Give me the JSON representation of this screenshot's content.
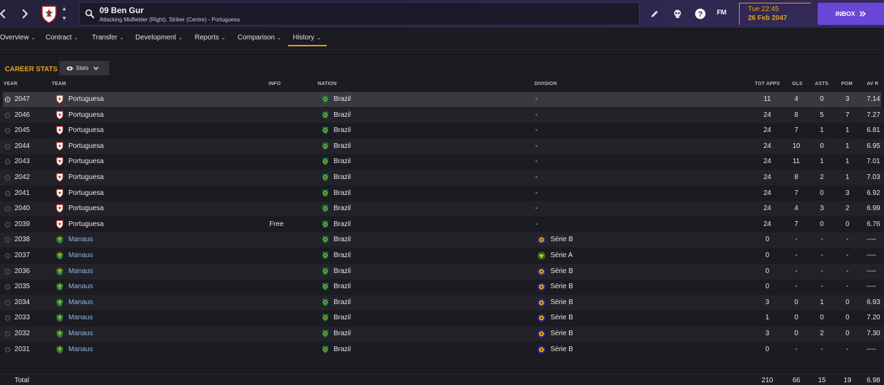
{
  "header": {
    "player_name": "09 Ben Gur",
    "player_positions": "Attacking Midfielder (Right), Striker (Centre) - Portuguesa",
    "time": "Tue 22:45",
    "date": "26 Feb 2047",
    "fm_label": "FM",
    "inbox_label": "INBOX",
    "accent": "#e8a21c",
    "inbox_color": "#6a46d6"
  },
  "tabs": [
    {
      "label": "Overview"
    },
    {
      "label": "Contract"
    },
    {
      "label": "Transfer"
    },
    {
      "label": "Development"
    },
    {
      "label": "Reports"
    },
    {
      "label": "Comparison"
    },
    {
      "label": "History"
    }
  ],
  "active_tab": "History",
  "section": {
    "title": "CAREER STATS",
    "view_dropdown": "Stats"
  },
  "columns": {
    "year": "YEAR",
    "team": "TEAM",
    "info": "INFO",
    "nation": "NATION",
    "division": "DIVISION",
    "apps": "TOT APPS",
    "gls": "GLS",
    "asts": "ASTS",
    "pom": "POM",
    "avr": "AV R"
  },
  "rows": [
    {
      "year": "2047",
      "team": "Portuguesa",
      "club": "portuguesa",
      "info": "",
      "nation": "Brazil",
      "division": "-",
      "div_badge": "",
      "apps": "11",
      "gls": "4",
      "asts": "0",
      "pom": "3",
      "avr": "7.14",
      "selected": true
    },
    {
      "year": "2046",
      "team": "Portuguesa",
      "club": "portuguesa",
      "info": "",
      "nation": "Brazil",
      "division": "-",
      "div_badge": "",
      "apps": "24",
      "gls": "8",
      "asts": "5",
      "pom": "7",
      "avr": "7.27"
    },
    {
      "year": "2045",
      "team": "Portuguesa",
      "club": "portuguesa",
      "info": "",
      "nation": "Brazil",
      "division": "-",
      "div_badge": "",
      "apps": "24",
      "gls": "7",
      "asts": "1",
      "pom": "1",
      "avr": "6.81"
    },
    {
      "year": "2044",
      "team": "Portuguesa",
      "club": "portuguesa",
      "info": "",
      "nation": "Brazil",
      "division": "-",
      "div_badge": "",
      "apps": "24",
      "gls": "10",
      "asts": "0",
      "pom": "1",
      "avr": "6.95"
    },
    {
      "year": "2043",
      "team": "Portuguesa",
      "club": "portuguesa",
      "info": "",
      "nation": "Brazil",
      "division": "-",
      "div_badge": "",
      "apps": "24",
      "gls": "11",
      "asts": "1",
      "pom": "1",
      "avr": "7.01"
    },
    {
      "year": "2042",
      "team": "Portuguesa",
      "club": "portuguesa",
      "info": "",
      "nation": "Brazil",
      "division": "-",
      "div_badge": "",
      "apps": "24",
      "gls": "8",
      "asts": "2",
      "pom": "1",
      "avr": "7.03"
    },
    {
      "year": "2041",
      "team": "Portuguesa",
      "club": "portuguesa",
      "info": "",
      "nation": "Brazil",
      "division": "-",
      "div_badge": "",
      "apps": "24",
      "gls": "7",
      "asts": "0",
      "pom": "3",
      "avr": "6.92"
    },
    {
      "year": "2040",
      "team": "Portuguesa",
      "club": "portuguesa",
      "info": "",
      "nation": "Brazil",
      "division": "-",
      "div_badge": "",
      "apps": "24",
      "gls": "4",
      "asts": "3",
      "pom": "2",
      "avr": "6.99"
    },
    {
      "year": "2039",
      "team": "Portuguesa",
      "club": "portuguesa",
      "info": "Free",
      "nation": "Brazil",
      "division": "-",
      "div_badge": "",
      "apps": "24",
      "gls": "7",
      "asts": "0",
      "pom": "0",
      "avr": "6.76"
    },
    {
      "year": "2038",
      "team": "Manaus",
      "club": "manaus",
      "info": "",
      "nation": "Brazil",
      "division": "Série B",
      "div_badge": "serie-b",
      "apps": "0",
      "gls": "-",
      "asts": "-",
      "pom": "-",
      "avr": "----"
    },
    {
      "year": "2037",
      "team": "Manaus",
      "club": "manaus",
      "info": "",
      "nation": "Brazil",
      "division": "Série A",
      "div_badge": "serie-a",
      "apps": "0",
      "gls": "-",
      "asts": "-",
      "pom": "-",
      "avr": "----"
    },
    {
      "year": "2036",
      "team": "Manaus",
      "club": "manaus",
      "info": "",
      "nation": "Brazil",
      "division": "Série B",
      "div_badge": "serie-b",
      "apps": "0",
      "gls": "-",
      "asts": "-",
      "pom": "-",
      "avr": "----"
    },
    {
      "year": "2035",
      "team": "Manaus",
      "club": "manaus",
      "info": "",
      "nation": "Brazil",
      "division": "Série B",
      "div_badge": "serie-b",
      "apps": "0",
      "gls": "-",
      "asts": "-",
      "pom": "-",
      "avr": "----"
    },
    {
      "year": "2034",
      "team": "Manaus",
      "club": "manaus",
      "info": "",
      "nation": "Brazil",
      "division": "Série B",
      "div_badge": "serie-b",
      "apps": "3",
      "gls": "0",
      "asts": "1",
      "pom": "0",
      "avr": "6.93"
    },
    {
      "year": "2033",
      "team": "Manaus",
      "club": "manaus",
      "info": "",
      "nation": "Brazil",
      "division": "Série B",
      "div_badge": "serie-b",
      "apps": "1",
      "gls": "0",
      "asts": "0",
      "pom": "0",
      "avr": "7.20"
    },
    {
      "year": "2032",
      "team": "Manaus",
      "club": "manaus",
      "info": "",
      "nation": "Brazil",
      "division": "Série B",
      "div_badge": "serie-b",
      "apps": "3",
      "gls": "0",
      "asts": "2",
      "pom": "0",
      "avr": "7.30"
    },
    {
      "year": "2031",
      "team": "Manaus",
      "club": "manaus",
      "info": "",
      "nation": "Brazil",
      "division": "Série B",
      "div_badge": "serie-b",
      "apps": "0",
      "gls": "-",
      "asts": "-",
      "pom": "-",
      "avr": "----"
    }
  ],
  "total": {
    "label": "Total",
    "apps": "210",
    "gls": "66",
    "asts": "15",
    "pom": "19",
    "avr": "6.98"
  },
  "icons": {
    "back": "chevron-left-icon",
    "forward": "chevron-right-icon",
    "search": "search-icon",
    "edit": "pencil-icon",
    "skull": "skull-icon",
    "help": "help-icon",
    "inbox": "double-chevron-right-icon"
  }
}
